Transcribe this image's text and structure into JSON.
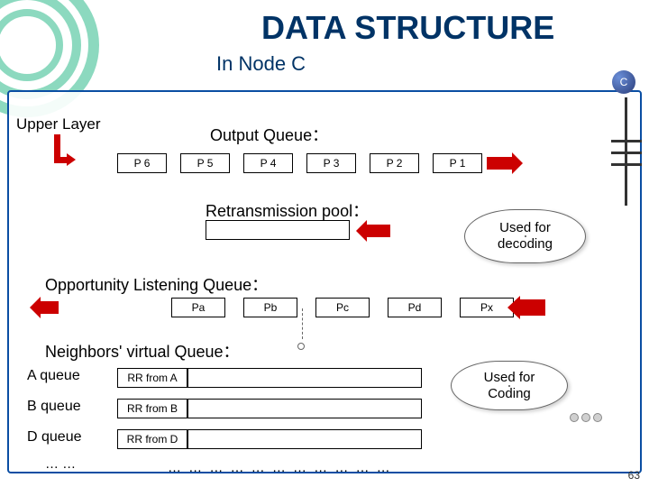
{
  "title": "DATA STRUCTURE",
  "subtitle": "In Node C",
  "node_badge": "C",
  "page_number": "63",
  "upper_layer_label": "Upper Layer",
  "output_queue": {
    "label": "Output Queue：",
    "packets": [
      "P 6",
      "P 5",
      "P 4",
      "P 3",
      "P 2",
      "P 1"
    ]
  },
  "retransmission": {
    "label": "Retransmission pool：",
    "cloud": "Used for\ndecoding"
  },
  "opportunity": {
    "label": "Opportunity Listening Queue：",
    "packets": [
      "Pa",
      "Pb",
      "Pc",
      "Pd",
      "Px"
    ]
  },
  "neighbors": {
    "label": "Neighbors' virtual Queue：",
    "rows": [
      {
        "name": "A queue",
        "rr": "RR from A"
      },
      {
        "name": "B queue",
        "rr": "RR from B"
      },
      {
        "name": "D queue",
        "rr": "RR from D"
      }
    ],
    "ellipsis": "… …",
    "dots": "… … … … … … … … … … …",
    "cloud": "Used for\nCoding"
  }
}
